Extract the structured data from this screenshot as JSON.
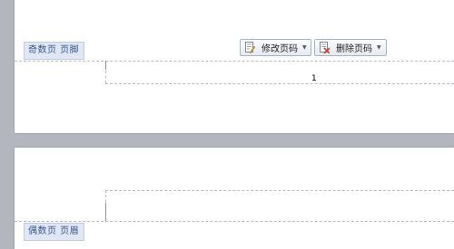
{
  "header_footer": {
    "odd_footer_label": "奇数页 页脚",
    "even_header_label": "偶数页 页眉"
  },
  "toolbar": {
    "modify_page_number": "修改页码",
    "delete_page_number": "删除页码"
  },
  "page": {
    "number": "1"
  },
  "icons": [
    "edit-page-number-icon",
    "delete-page-number-icon",
    "dropdown-arrow-icon"
  ]
}
